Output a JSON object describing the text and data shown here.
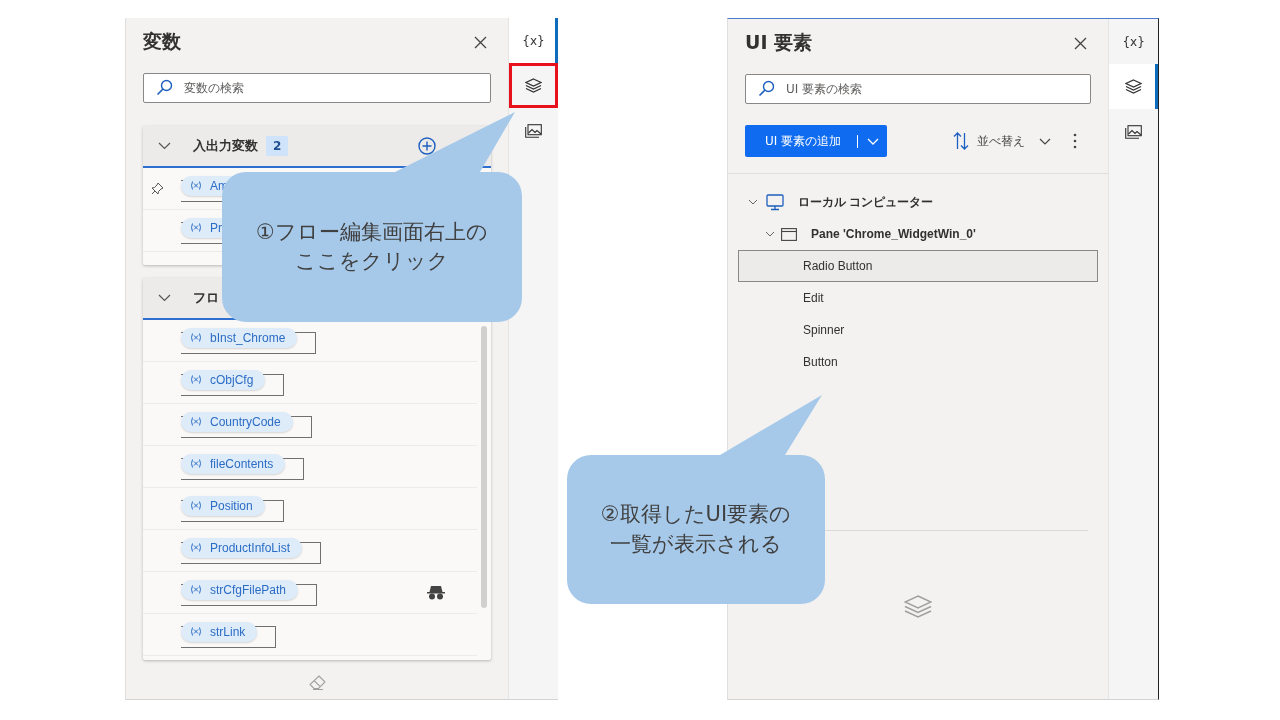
{
  "variables_panel": {
    "title": "変数",
    "search": {
      "placeholder": "変数の検索"
    },
    "sections": [
      {
        "title": "入出力変数",
        "count": "2",
        "expanded": true,
        "addable": true,
        "rows": [
          {
            "name": "Am",
            "pinned": true,
            "sensitive": false
          },
          {
            "name": "Pr",
            "pinned": false,
            "sensitive": false
          }
        ]
      },
      {
        "title": "フロ",
        "expanded": true,
        "addable": false,
        "rows": [
          {
            "name": "bInst_Chrome",
            "pinned": false,
            "sensitive": false
          },
          {
            "name": "cObjCfg",
            "pinned": false,
            "sensitive": false
          },
          {
            "name": "CountryCode",
            "pinned": false,
            "sensitive": false
          },
          {
            "name": "fileContents",
            "pinned": false,
            "sensitive": false
          },
          {
            "name": "Position",
            "pinned": false,
            "sensitive": false
          },
          {
            "name": "ProductInfoList",
            "pinned": false,
            "sensitive": false
          },
          {
            "name": "strCfgFilePath",
            "pinned": false,
            "sensitive": true
          },
          {
            "name": "strLink",
            "pinned": false,
            "sensitive": false
          }
        ]
      }
    ],
    "rail": [
      {
        "kind": "variables",
        "label": "{x}",
        "selected": true,
        "highlighted": false
      },
      {
        "kind": "ui-elements",
        "selected": false,
        "highlighted": true
      },
      {
        "kind": "images",
        "selected": false,
        "highlighted": false
      }
    ]
  },
  "ui_elements_panel": {
    "title": "UI 要素",
    "search": {
      "placeholder": "UI 要素の検索"
    },
    "add_button": "UI 要素の追加",
    "sort_label": "並べ替え",
    "tree": [
      {
        "label": "ローカル コンピューター",
        "kind": "computer",
        "expanded": true,
        "children": [
          {
            "label": "Pane 'Chrome_WidgetWin_0'",
            "kind": "window",
            "expanded": true,
            "children": [
              {
                "label": "Radio Button",
                "selected": true
              },
              {
                "label": "Edit",
                "selected": false
              },
              {
                "label": "Spinner",
                "selected": false
              },
              {
                "label": "Button",
                "selected": false
              }
            ]
          }
        ]
      }
    ],
    "rail": [
      {
        "kind": "variables",
        "label": "{x}",
        "selected": false,
        "highlighted": false
      },
      {
        "kind": "ui-elements",
        "selected": true,
        "highlighted": false
      },
      {
        "kind": "images",
        "selected": false,
        "highlighted": false
      }
    ]
  },
  "callouts": [
    {
      "text": "①フロー編集画面右上のここをクリック"
    },
    {
      "text": "②取得したUI要素の一覧が表示される"
    }
  ]
}
